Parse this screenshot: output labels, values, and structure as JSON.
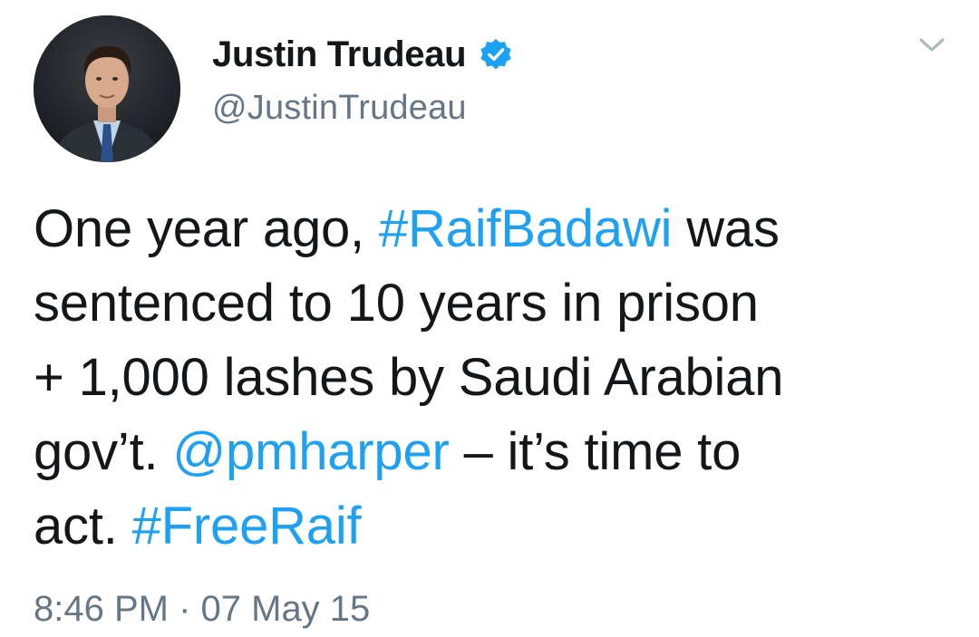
{
  "tweet": {
    "author": {
      "display_name": "Justin Trudeau",
      "handle": "@JustinTrudeau",
      "verified": true,
      "verified_icon": "verified-badge-icon",
      "avatar_icon": "profile-photo"
    },
    "menu_icon": "chevron-down-icon",
    "text": {
      "line1_a": "One year ago, ",
      "line1_hashtag": "#RaifBadawi",
      "line1_b": " was",
      "line2": "sentenced to 10 years in prison",
      "line3": "+ 1,000 lashes by Saudi Arabian",
      "line4_a": "gov’t. ",
      "line4_mention": "@pmharper",
      "line4_b": " – it’s time to",
      "line5_a": "act. ",
      "line5_hashtag": "#FreeRaif"
    },
    "timestamp": "8:46 PM · 07 May 15"
  },
  "colors": {
    "link": "#1da1f2",
    "verified": "#1da1f2",
    "text": "#14171a",
    "secondary": "#657786",
    "chevron": "#aab8c2"
  }
}
